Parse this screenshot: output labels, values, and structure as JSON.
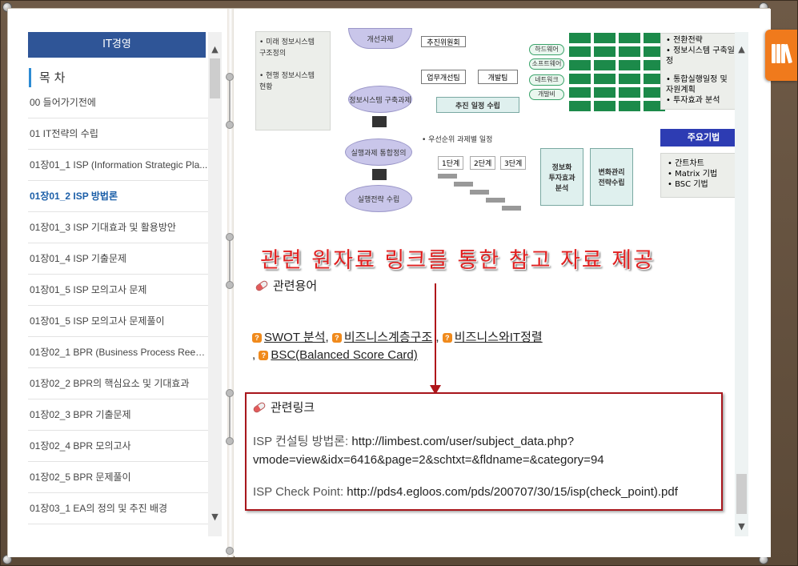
{
  "toc": {
    "header": "IT경영",
    "title": "목 차",
    "items": [
      "00 들어가기전에",
      "01 IT전략의 수립",
      "01장01_1 ISP (Information Strategic Pla...",
      "01장01_2 ISP 방법론",
      "01장01_3 ISP 기대효과 및 활용방안",
      "01장01_4 ISP 기출문제",
      "01장01_5 ISP 모의고사 문제",
      "01장01_5 ISP 모의고사 문제풀이",
      "01장02_1 BPR (Business Process Reeng...",
      "01장02_2 BPR의 핵심요소 및 기대효과",
      "01장02_3 BPR 기출문제",
      "01장02_4 BPR 모의고사",
      "01장02_5 BPR 문제풀이",
      "01장03_1 EA의 정의 및 추진 배경"
    ],
    "active_index": 3
  },
  "diagram": {
    "left_panel": [
      "• 미래 정보시스템",
      "  구조정의",
      "• 현행 정보시스템",
      "  현황"
    ],
    "oval_top": "개선과제",
    "oval_1": "정보시스템\n구축과제",
    "oval_2": "실행과제 통합정의",
    "oval_3": "실행전략 수립",
    "org_top": "추진위원회",
    "org_left": "업무개선팀",
    "org_right": "개발팀",
    "plan_box": "추진 일정 수립",
    "priority_note": "• 우선순위 과제별 일정",
    "steps": [
      "1단계",
      "2단계",
      "3단계"
    ],
    "pills": [
      "하드웨어",
      "소프트웨어",
      "네트워크",
      "개발비"
    ],
    "box_invest": "정보화\n투자효과\n분석",
    "box_change": "변화관리\n전략수립",
    "right_top": [
      "• 전환전략",
      "• 정보시스템 구축일정",
      "• 통합실행일정 및",
      "  자원계획",
      "• 투자효과 분석"
    ],
    "method_title": "주요기법",
    "methods": [
      "• 간트차트",
      "• Matrix 기법",
      "• BSC 기법"
    ]
  },
  "headline": "관련 원자료 링크를 통한 참고 자료 제공",
  "terms_section": {
    "title": "관련용어",
    "terms": [
      "SWOT 분석",
      "비즈니스계층구조",
      "비즈니스와IT정렬",
      "BSC(Balanced Score Card)"
    ]
  },
  "links_section": {
    "title": "관련링크",
    "links": [
      {
        "label": "ISP 컨설팅 방법론:",
        "url_line1": "http://limbest.com/user/subject_data.php?",
        "url_line2": "vmode=view&idx=6416&page=2&schtxt=&fldname=&category=94"
      },
      {
        "label": "ISP Check Point:",
        "url_line1": "http://pds4.egloos.com/pds/200707/30/15/isp(check_point).pdf"
      }
    ]
  },
  "colors": {
    "accent_blue": "#2f5597",
    "headline_red": "#e02020",
    "box_border_red": "#a8161c",
    "side_tab_orange": "#f07a1c"
  }
}
